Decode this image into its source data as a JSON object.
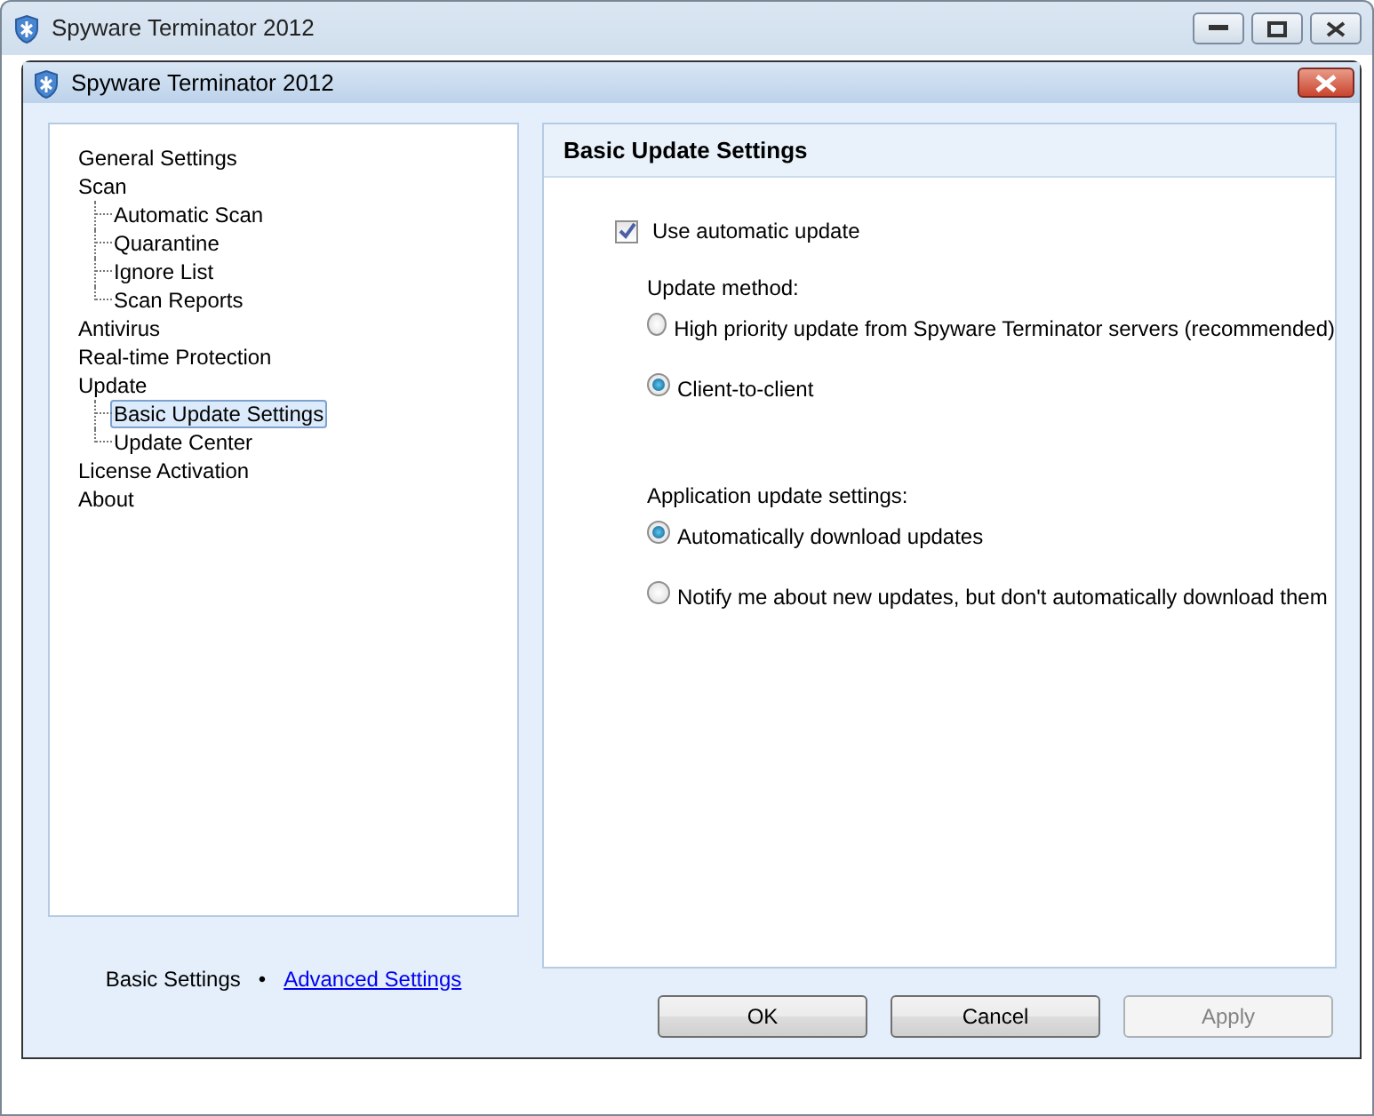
{
  "window": {
    "title": "Spyware Terminator 2012"
  },
  "dialog": {
    "title": "Spyware Terminator 2012"
  },
  "tree": [
    {
      "label": "General Settings",
      "selected": false
    },
    {
      "label": "Scan",
      "selected": false,
      "children": [
        {
          "label": "Automatic Scan",
          "selected": false
        },
        {
          "label": "Quarantine",
          "selected": false
        },
        {
          "label": "Ignore List",
          "selected": false
        },
        {
          "label": "Scan Reports",
          "selected": false
        }
      ]
    },
    {
      "label": "Antivirus",
      "selected": false
    },
    {
      "label": "Real-time Protection",
      "selected": false
    },
    {
      "label": "Update",
      "selected": false,
      "children": [
        {
          "label": "Basic Update Settings",
          "selected": true
        },
        {
          "label": "Update Center",
          "selected": false
        }
      ]
    },
    {
      "label": "License Activation",
      "selected": false
    },
    {
      "label": "About",
      "selected": false
    }
  ],
  "footer_links": [
    {
      "kind": "text",
      "label": "Basic Settings"
    },
    {
      "kind": "separator",
      "label": "•"
    },
    {
      "kind": "link",
      "label": "Advanced Settings"
    }
  ],
  "panel": {
    "title": "Basic Update Settings",
    "options": [
      {
        "kind": "checkbox",
        "label": "Use automatic update",
        "checked": true
      },
      {
        "kind": "heading",
        "label": "Update method:"
      },
      {
        "kind": "radio",
        "label": "High priority update from Spyware Terminator servers (recommended)",
        "selected": false
      },
      {
        "kind": "radio",
        "label": "Client-to-client",
        "selected": true
      },
      {
        "kind": "heading",
        "label": "Application update settings:"
      },
      {
        "kind": "radio",
        "label": "Automatically download updates",
        "selected": true
      },
      {
        "kind": "radio",
        "label": "Notify me about new updates, but don't automatically download them",
        "selected": false
      }
    ]
  },
  "buttons": [
    {
      "label": "OK",
      "disabled": false
    },
    {
      "label": "Cancel",
      "disabled": false
    },
    {
      "label": "Apply",
      "disabled": true
    }
  ]
}
